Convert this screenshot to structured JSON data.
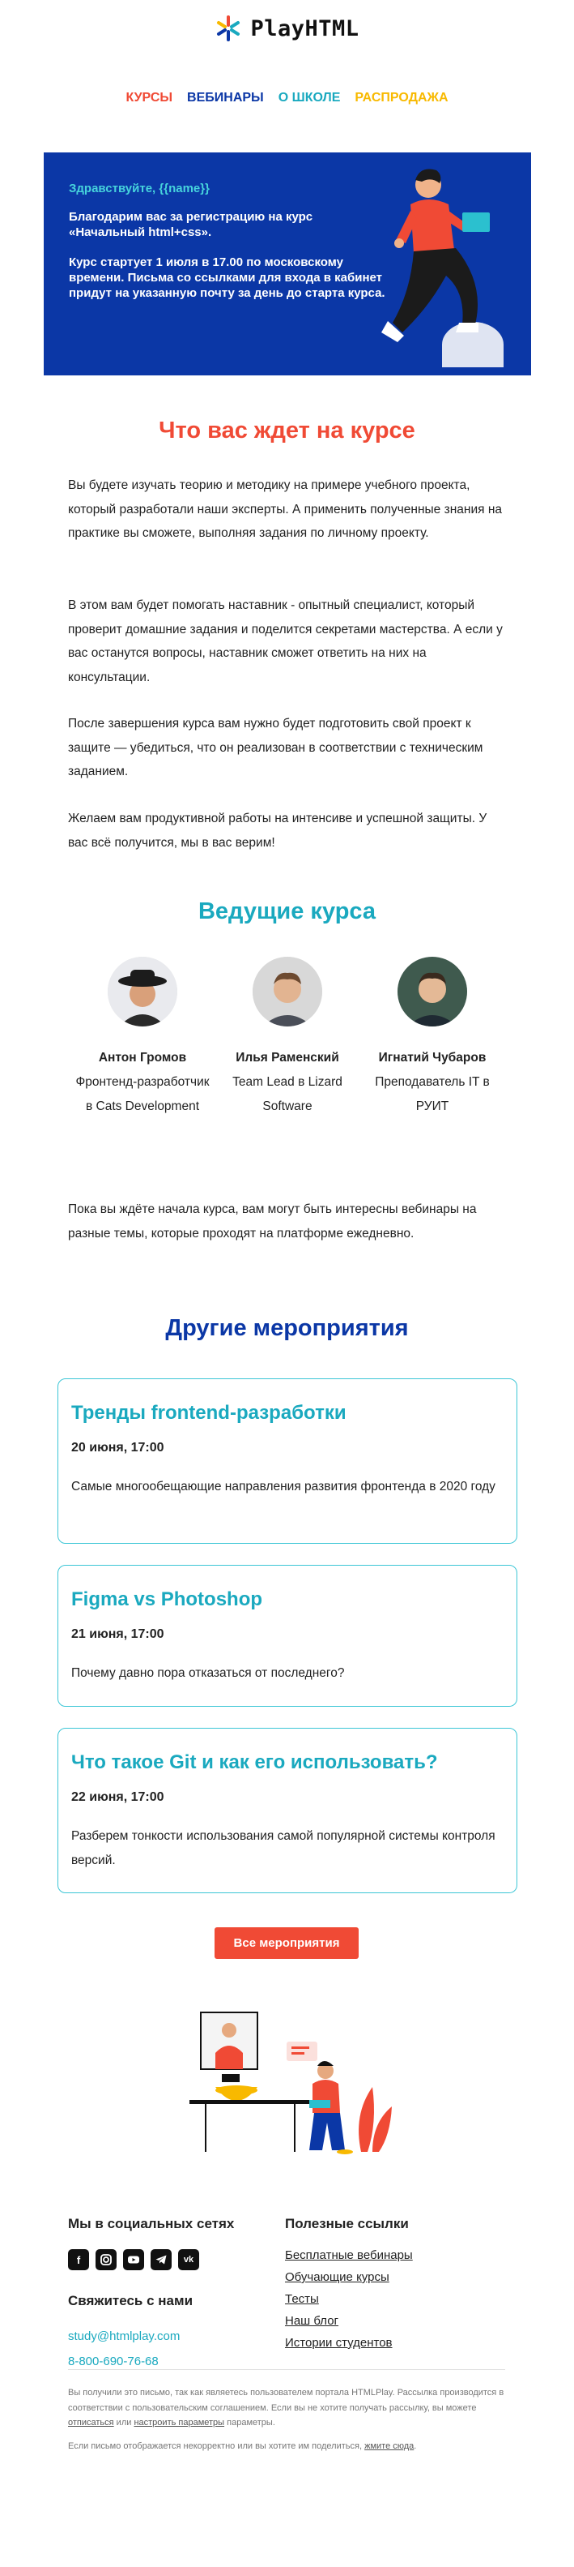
{
  "brand": {
    "name": "PlayHTML"
  },
  "nav": [
    {
      "label": "Курсы",
      "color": "#f04a35"
    },
    {
      "label": "Вебинары",
      "color": "#0b37a6"
    },
    {
      "label": "О школе",
      "color": "#1aa9bf"
    },
    {
      "label": "Распродажа",
      "color": "#f8b900"
    }
  ],
  "banner": {
    "greeting": "Здравствуйте, {{name}}",
    "text1": "Благодарим вас за регистрацию на курс «Начальный html+css».",
    "text2": "Курс стартует 1 июля в 17.00 по московскому времени. Письма со ссылками для входа в кабинет придут на указанную почту за день до старта курса."
  },
  "intro": {
    "heading": "Что вас ждет на курсе",
    "p1": "Вы будете изучать теорию и методику на примере учебного проекта, который разработали наши эксперты. А применить полученные знания на практике вы сможете, выполняя задания по личному проекту.",
    "p2": "В этом вам будет помогать наставник - опытный специалист, который проверит домашние задания и поделится секретами мастерства. А если у вас останутся вопросы, наставник сможет ответить на них на консультации.",
    "p3": "После завершения курса вам нужно будет подготовить свой проект к защите — убедиться, что он реализован в соответствии с техническим заданием.",
    "p4": "Желаем вам продуктивной работы на интенсиве и успешной защиты. У вас всё получится, мы в вас верим!"
  },
  "teachers": {
    "heading": "Ведущие курса",
    "items": [
      {
        "name": "Антон Громов",
        "role": "Фронтенд-разработчик в Cats Development"
      },
      {
        "name": "Илья Раменский",
        "role": "Team Lead в Lizard Software"
      },
      {
        "name": "Игнатий Чубаров",
        "role": "Преподаватель IT в РУИТ"
      }
    ]
  },
  "webinars_note": "Пока вы ждёте начала курса, вам могут быть интересны вебинары на разные темы, которые проходят на платформе ежедневно.",
  "events": {
    "heading": "Другие мероприятия",
    "items": [
      {
        "title": "Тренды frontend-разработки",
        "date": "20 июня, 17:00",
        "desc": "Самые многообещающие направления развития фронтенда в 2020 году"
      },
      {
        "title": "Figma vs Photoshop",
        "date": "21 июня, 17:00",
        "desc": "Почему давно пора отказаться от последнего?"
      },
      {
        "title": "Что такое Git и как его использовать?",
        "date": "22 июня, 17:00",
        "desc": "Разберем тонкости использования самой популярной системы контроля версий."
      }
    ],
    "all_button": "Все мероприятия"
  },
  "footer": {
    "social_heading": "Мы в социальных сетях",
    "socials": [
      "facebook-icon",
      "instagram-icon",
      "youtube-icon",
      "telegram-icon",
      "vk-icon"
    ],
    "contact_heading": "Свяжитесь с нами",
    "email": "study@htmlplay.com",
    "phone": "8-800-690-76-68",
    "links_heading": "Полезные ссылки",
    "links": [
      "Бесплатные вебинары",
      "Обучающие курсы",
      "Тесты",
      "Наш блог",
      "Истории студентов"
    ],
    "legal1_a": "Вы получили это письмо, так как являетесь пользователем портала HTMLPlay. Рассылка производится в соответствии с пользовательским соглашением. Если вы не хотите получать рассылку, вы можете ",
    "legal1_unsub": "отписаться",
    "legal1_b": " или ",
    "legal1_settings": "настроить параметры",
    "legal1_c": " параметры.",
    "legal2_a": "Если письмо отображается некорректно или вы хотите им поделиться, ",
    "legal2_link": "жмите сюда",
    "legal2_b": "."
  },
  "colors": {
    "accent_red": "#f04a35",
    "accent_blue": "#0b37a6",
    "accent_teal": "#1aa9bf"
  }
}
